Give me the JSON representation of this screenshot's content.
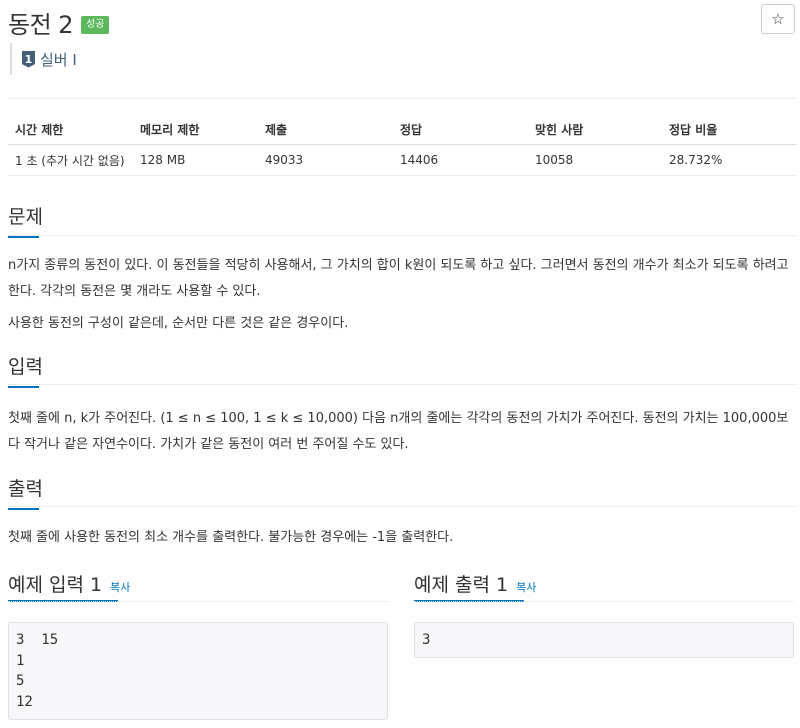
{
  "problem": {
    "title": "동전 2",
    "status_badge": "성공",
    "star_icon": "☆",
    "tier_number": "1",
    "tier_label": "실버 I"
  },
  "info_table": {
    "headers": [
      "시간 제한",
      "메모리 제한",
      "제출",
      "정답",
      "맞힌 사람",
      "정답 비율"
    ],
    "row": [
      "1 초 (추가 시간 없음)",
      "128 MB",
      "49033",
      "14406",
      "10058",
      "28.732%"
    ]
  },
  "sections": {
    "problem": {
      "title": "문제",
      "paragraphs": [
        "n가지 종류의 동전이 있다. 이 동전들을 적당히 사용해서, 그 가치의 합이 k원이 되도록 하고 싶다. 그러면서 동전의 개수가 최소가 되도록 하려고 한다. 각각의 동전은 몇 개라도 사용할 수 있다.",
        "사용한 동전의 구성이 같은데, 순서만 다른 것은 같은 경우이다."
      ]
    },
    "input": {
      "title": "입력",
      "paragraphs": [
        "첫째 줄에 n, k가 주어진다. (1 ≤ n ≤ 100, 1 ≤ k ≤ 10,000) 다음 n개의 줄에는 각각의 동전의 가치가 주어진다. 동전의 가치는 100,000보다 작거나 같은 자연수이다. 가치가 같은 동전이 여러 번 주어질 수도 있다."
      ]
    },
    "output": {
      "title": "출력",
      "paragraphs": [
        "첫째 줄에 사용한 동전의 최소 개수를 출력한다. 불가능한 경우에는 -1을 출력한다."
      ]
    }
  },
  "examples": {
    "input": {
      "title": "예제 입력 1",
      "copy_label": "복사",
      "lines": [
        "3  15",
        "1",
        "5",
        "12"
      ]
    },
    "output": {
      "title": "예제 출력 1",
      "copy_label": "복사",
      "lines": [
        "3"
      ]
    }
  },
  "colors": {
    "accent": "#0076c0",
    "success_badge": "#5cb85c",
    "tier_silver": "#435f7a"
  }
}
